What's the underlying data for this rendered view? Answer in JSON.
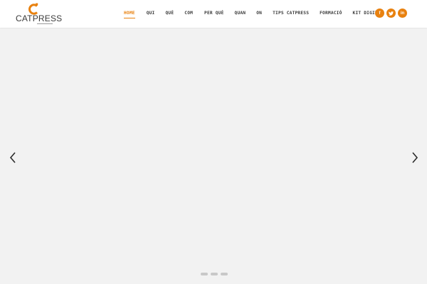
{
  "brand": {
    "name": "CATPRESS",
    "accent": "#e8810f",
    "icon": "catpress-logo-icon"
  },
  "nav": {
    "items": [
      {
        "label": "HOME",
        "active": true
      },
      {
        "label": "QUI"
      },
      {
        "label": "QUÈ"
      },
      {
        "label": "COM"
      },
      {
        "label": "PER QUÈ"
      },
      {
        "label": "QUAN"
      },
      {
        "label": "ON"
      },
      {
        "label": "TIPS CATPRESS"
      },
      {
        "label": "FORMACIÓ"
      },
      {
        "label": "KIT DIGITAL"
      }
    ]
  },
  "social": {
    "facebook": "f",
    "twitter": "twitter-icon",
    "linkedin": "in"
  },
  "slider": {
    "background": "#f2f2f2",
    "prev_icon": "chevron-left-icon",
    "next_icon": "chevron-right-icon",
    "slide_count": 3
  }
}
